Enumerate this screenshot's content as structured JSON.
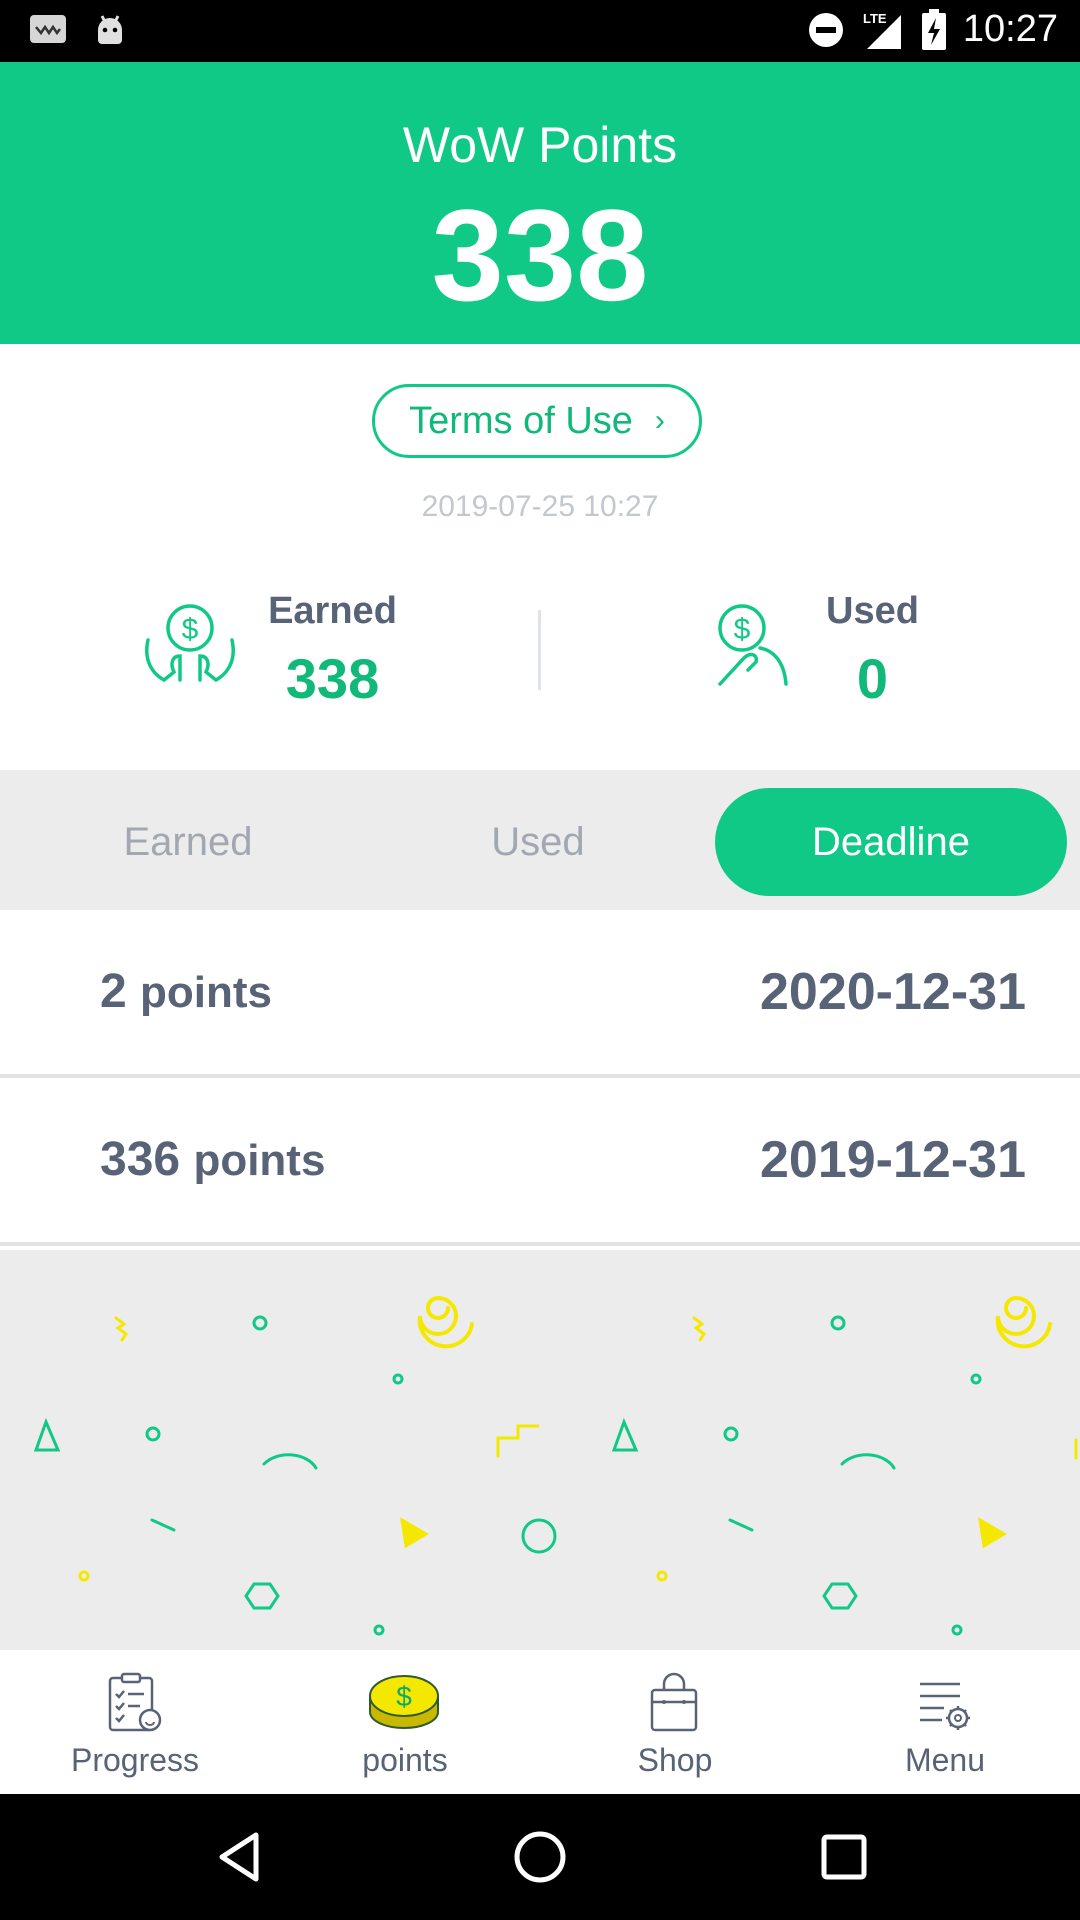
{
  "status_bar": {
    "time": "10:27",
    "network": "LTE"
  },
  "header": {
    "title": "WoW Points",
    "points": "338"
  },
  "terms": {
    "label": "Terms of Use",
    "chevron": "›"
  },
  "timestamp": "2019-07-25 10:27",
  "summary": {
    "earned": {
      "label": "Earned",
      "value": "338",
      "icon": "hands-holding-coin-icon"
    },
    "used": {
      "label": "Used",
      "value": "0",
      "icon": "hand-giving-coin-icon"
    }
  },
  "tabs": [
    {
      "label": "Earned",
      "active": false
    },
    {
      "label": "Used",
      "active": false
    },
    {
      "label": "Deadline",
      "active": true
    }
  ],
  "deadline_list": [
    {
      "amount": "2",
      "unit": "points",
      "date": "2020-12-31"
    },
    {
      "amount": "336",
      "unit": "points",
      "date": "2019-12-31"
    }
  ],
  "bottom_nav": [
    {
      "label": "Progress",
      "icon": "checklist-icon",
      "active": false
    },
    {
      "label": "points",
      "icon": "coin-icon",
      "active": true
    },
    {
      "label": "Shop",
      "icon": "shopping-bag-icon",
      "active": false
    },
    {
      "label": "Menu",
      "icon": "menu-settings-icon",
      "active": false
    }
  ],
  "colors": {
    "accent": "#10c986",
    "text": "#586377",
    "muted": "#a2a8b2",
    "confetti_yellow": "#f5e800"
  }
}
